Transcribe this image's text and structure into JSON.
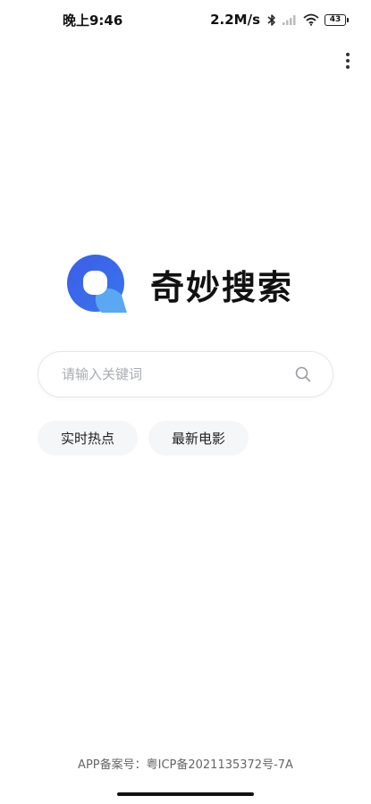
{
  "status_bar": {
    "time": "晚上9:46",
    "speed": "2.2M/s",
    "battery": "43"
  },
  "brand": {
    "title": "奇妙搜索",
    "logo_icon": "q-search-logo-icon",
    "logo_color": "#3a62e8",
    "logo_accent": "#5aa7f2"
  },
  "search": {
    "placeholder": "请输入关键词",
    "value": ""
  },
  "chips": [
    {
      "label": "实时热点"
    },
    {
      "label": "最新电影"
    }
  ],
  "footer": {
    "icp": "APP备案号：粤ICP备2021135372号-7A"
  }
}
